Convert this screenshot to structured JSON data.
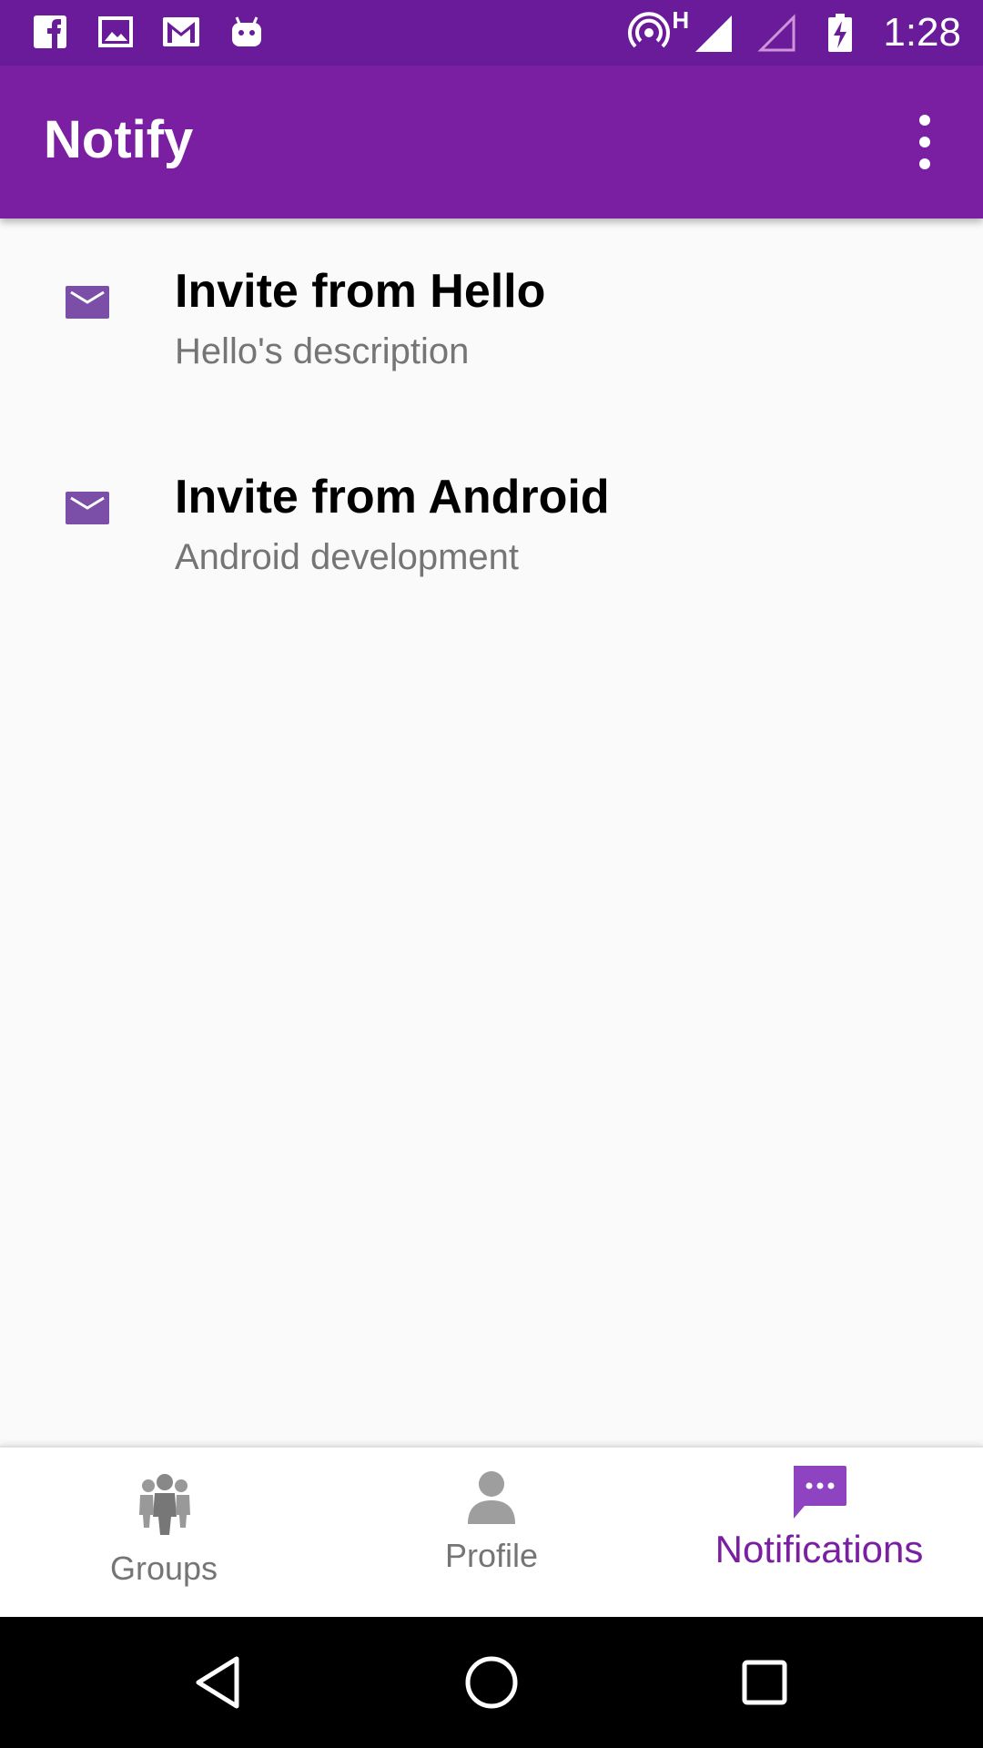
{
  "status_bar": {
    "time": "1:28",
    "network_label": "H",
    "left_icons": [
      "facebook-icon",
      "image-icon",
      "gmail-icon",
      "android-icon"
    ],
    "right_icons": [
      "hotspot-icon",
      "signal-full-icon",
      "signal-empty-icon",
      "battery-charging-icon"
    ]
  },
  "app_bar": {
    "title": "Notify",
    "menu_icon": "more-vert-icon"
  },
  "notifications": [
    {
      "title": "Invite from Hello",
      "description": "Hello's description",
      "icon": "mail-icon"
    },
    {
      "title": "Invite from Android",
      "description": "Android development",
      "icon": "mail-icon"
    }
  ],
  "bottom_nav": {
    "items": [
      {
        "label": "Groups",
        "icon": "groups-icon",
        "active": false
      },
      {
        "label": "Profile",
        "icon": "person-icon",
        "active": false
      },
      {
        "label": "Notifications",
        "icon": "chat-bubble-icon",
        "active": true
      }
    ]
  },
  "system_nav": {
    "buttons": [
      "back-icon",
      "home-icon",
      "recents-icon"
    ]
  },
  "colors": {
    "status_bar": "#6a1b9a",
    "app_bar": "#7b1fa2",
    "accent": "#7b1fa2",
    "inactive": "#757575",
    "background": "#fafafa"
  }
}
